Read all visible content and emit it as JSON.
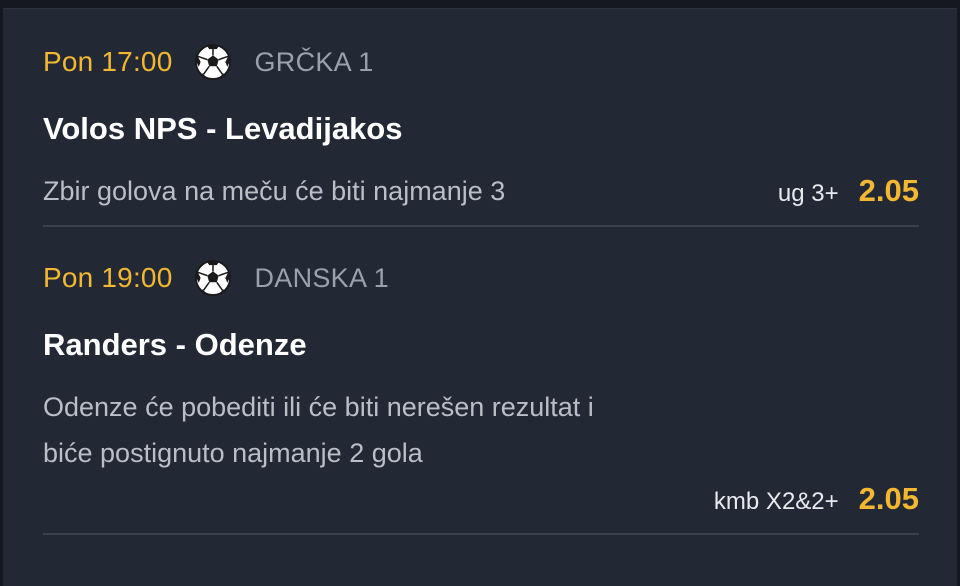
{
  "matches": [
    {
      "time": "Pon 17:00",
      "sport_icon": "soccer-ball-icon",
      "league": "GRČKA 1",
      "teams": "Volos NPS - Levadijakos",
      "bet_description": "Zbir golova na meču će biti najmanje 3",
      "bet_code": "ug 3+",
      "odds": "2.05"
    },
    {
      "time": "Pon 19:00",
      "sport_icon": "soccer-ball-icon",
      "league": "DANSKA 1",
      "teams": "Randers - Odenze",
      "bet_description": "Odenze će pobediti ili će biti nerešen rezultat i biće postignuto najmanje 2 gola",
      "bet_code": "kmb X2&2+",
      "odds": "2.05"
    }
  ],
  "colors": {
    "background": "#222834",
    "accent": "#f4b731",
    "league_text": "#9aa1ad",
    "description_text": "#b9bec7",
    "divider": "#3a414e"
  }
}
